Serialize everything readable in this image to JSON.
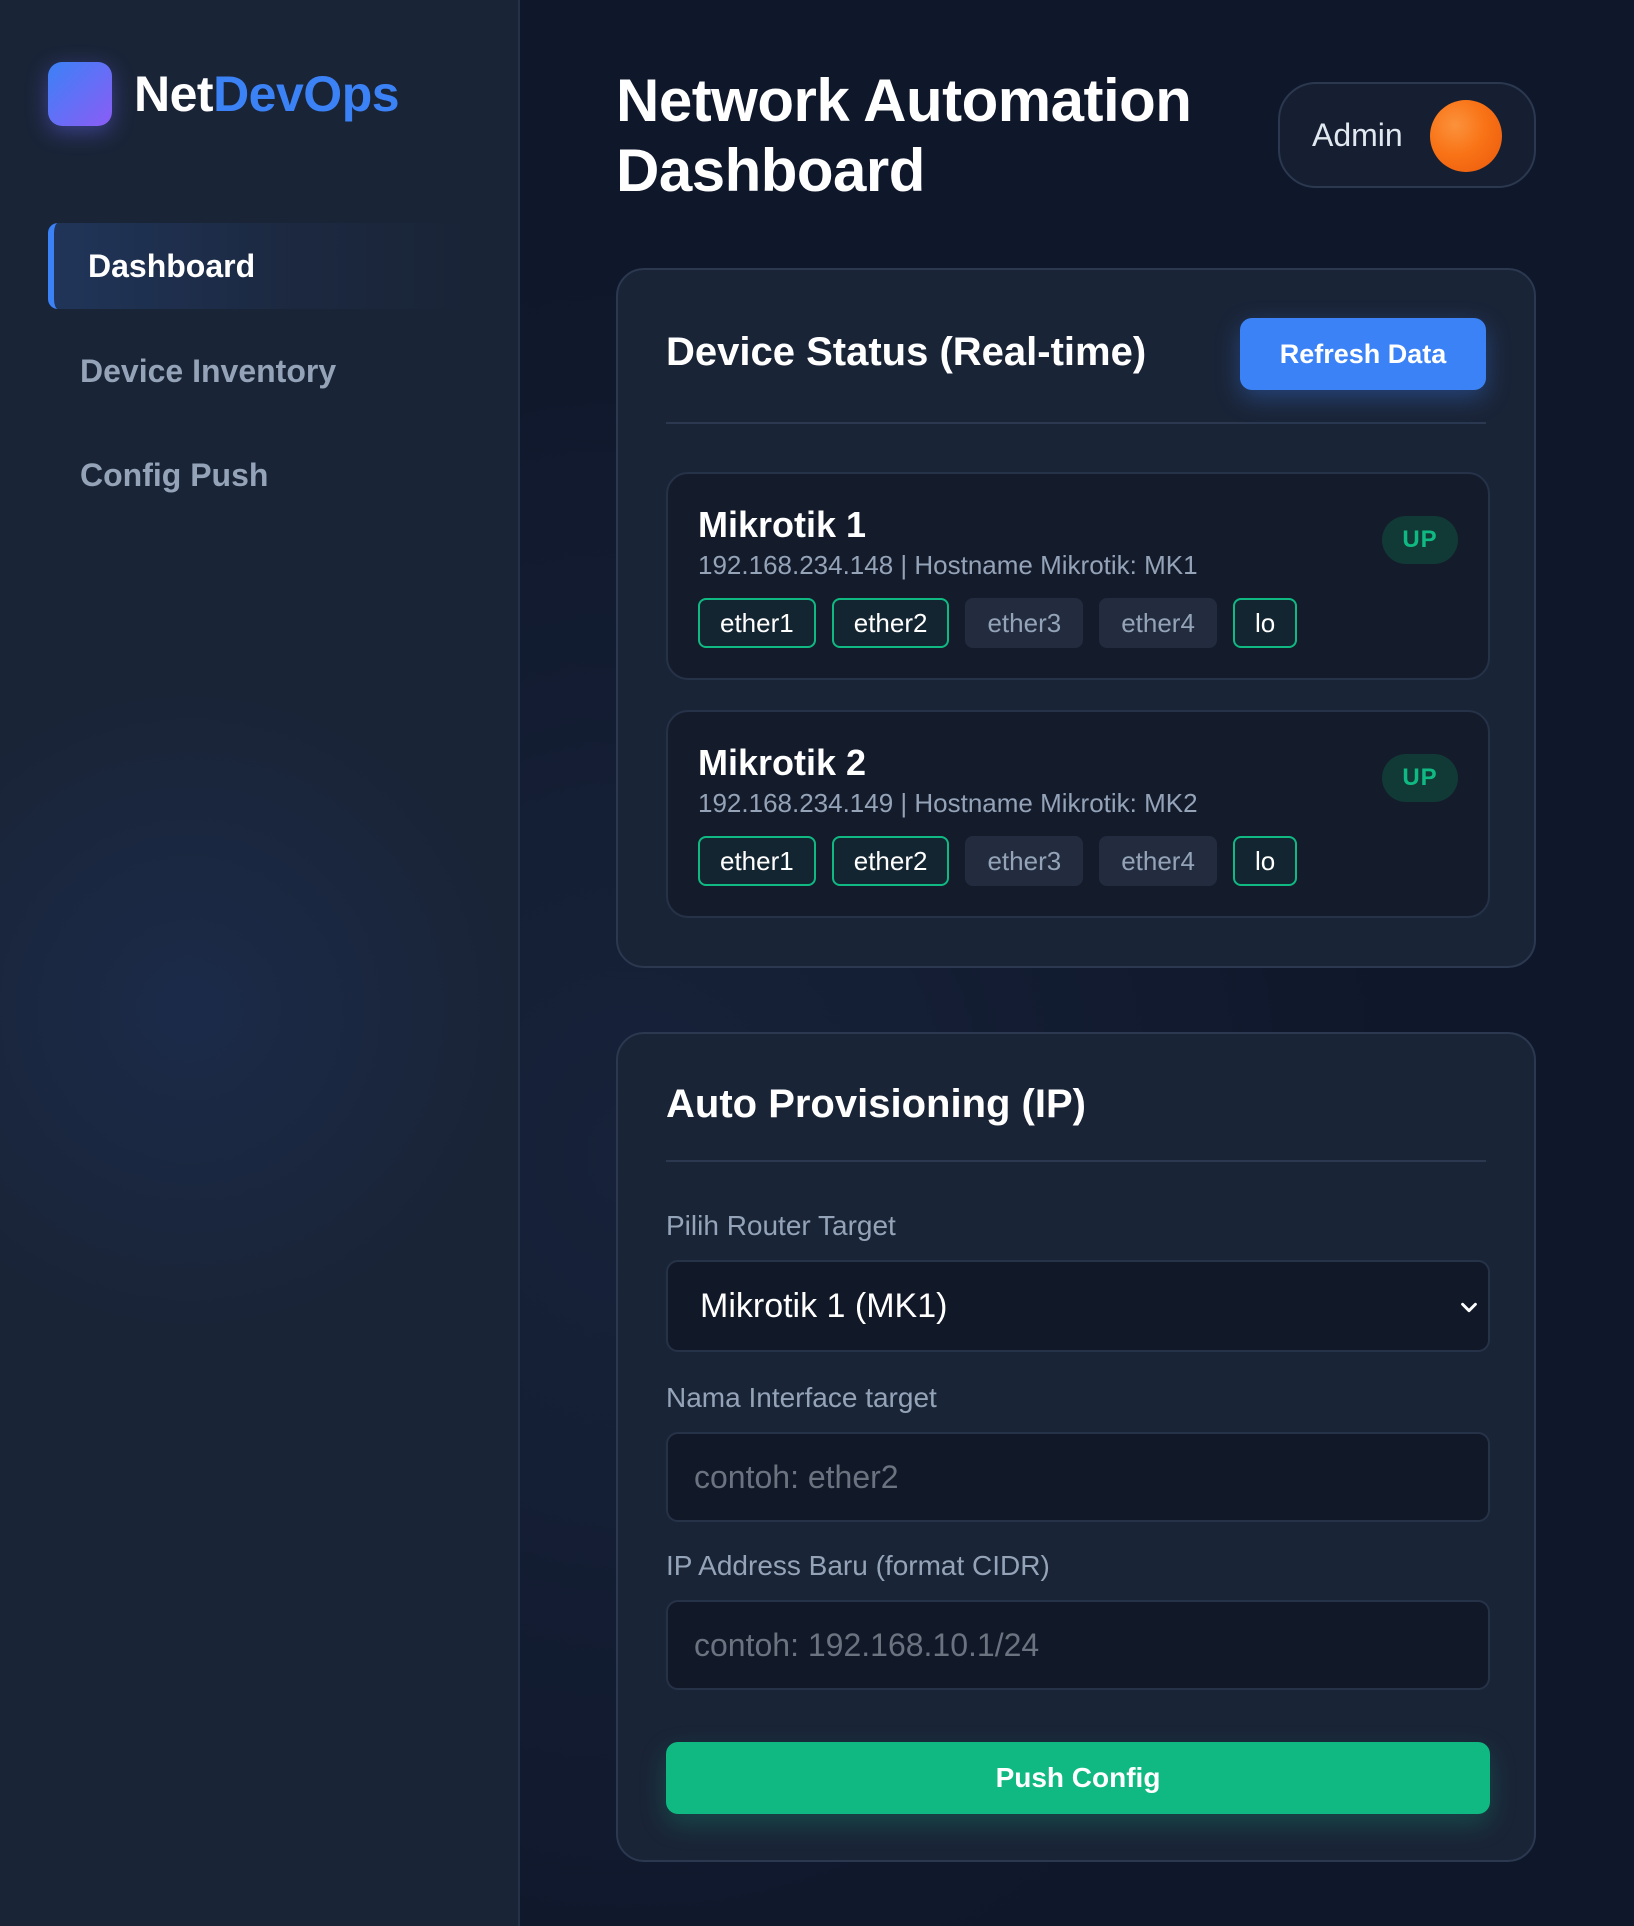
{
  "brand": {
    "name_part1": "Net",
    "name_part2": "DevOps"
  },
  "sidebar": {
    "items": [
      {
        "label": "Dashboard",
        "active": true
      },
      {
        "label": "Device Inventory",
        "active": false
      },
      {
        "label": "Config Push",
        "active": false
      }
    ]
  },
  "header": {
    "title": "Network Automation Dashboard",
    "user": "Admin"
  },
  "device_status": {
    "title": "Device Status (Real-time)",
    "refresh_label": "Refresh Data",
    "devices": [
      {
        "name": "Mikrotik 1",
        "meta": "192.168.234.148 | Hostname Mikrotik: MK1",
        "status": "UP",
        "interfaces": [
          {
            "name": "ether1",
            "up": true
          },
          {
            "name": "ether2",
            "up": true
          },
          {
            "name": "ether3",
            "up": false
          },
          {
            "name": "ether4",
            "up": false
          },
          {
            "name": "lo",
            "up": true
          }
        ]
      },
      {
        "name": "Mikrotik 2",
        "meta": "192.168.234.149 | Hostname Mikrotik: MK2",
        "status": "UP",
        "interfaces": [
          {
            "name": "ether1",
            "up": true
          },
          {
            "name": "ether2",
            "up": true
          },
          {
            "name": "ether3",
            "up": false
          },
          {
            "name": "ether4",
            "up": false
          },
          {
            "name": "lo",
            "up": true
          }
        ]
      }
    ]
  },
  "provisioning": {
    "title": "Auto Provisioning (IP)",
    "router_label": "Pilih Router Target",
    "router_selected": "Mikrotik 1 (MK1)",
    "interface_label": "Nama Interface target",
    "interface_placeholder": "contoh: ether2",
    "ip_label": "IP Address Baru (format CIDR)",
    "ip_placeholder": "contoh: 192.168.10.1/24",
    "push_label": "Push Config"
  },
  "colors": {
    "accent": "#3b82f6",
    "success": "#10b981",
    "background": "#0f172a",
    "card": "#1a2437"
  }
}
